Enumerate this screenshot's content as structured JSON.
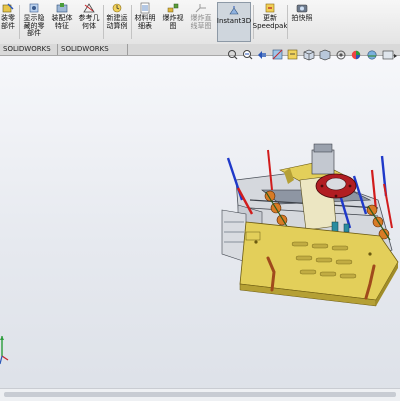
{
  "toolbar": {
    "buttons": [
      {
        "key": "edit-component",
        "label": "装零\n部件",
        "icon": "edit-component-icon"
      },
      {
        "key": "show-hidden",
        "label": "显示隐\n藏的零\n部件",
        "icon": "show-hidden-icon"
      },
      {
        "key": "assembly-features",
        "label": "装配体\n特征",
        "icon": "assembly-features-icon"
      },
      {
        "key": "reference-geometry",
        "label": "参考几\n何体",
        "icon": "reference-geometry-icon"
      },
      {
        "key": "new-motion-study",
        "label": "新建运\n动算例",
        "icon": "new-motion-study-icon"
      },
      {
        "key": "bill-of-materials",
        "label": "材料明\n细表",
        "icon": "bill-of-materials-icon"
      },
      {
        "key": "exploded-view",
        "label": "爆炸视\n图",
        "icon": "exploded-view-icon"
      },
      {
        "key": "explode-line-sketch",
        "label": "爆炸直\n线草图",
        "icon": "explode-line-sketch-icon"
      },
      {
        "key": "instant3d",
        "label": "Instant3D",
        "icon": "instant3d-icon"
      },
      {
        "key": "update-speedpak",
        "label": "更新\nSpeedpak",
        "icon": "update-speedpak-icon"
      },
      {
        "key": "take-snapshot",
        "label": "拍快照",
        "icon": "snapshot-icon"
      }
    ]
  },
  "tabs": [
    {
      "label": "SOLIDWORKS 插件"
    },
    {
      "label": "SOLIDWORKS MBD"
    }
  ],
  "heads_up_toolbar": [
    "zoom-to-fit-icon",
    "zoom-area-icon",
    "previous-view-icon",
    "section-view-icon",
    "dynamic-annotation-icon",
    "view-orientation-icon",
    "display-style-icon",
    "hide-show-items-icon",
    "edit-appearance-icon",
    "apply-scene-icon",
    "view-settings-icon"
  ],
  "colors": {
    "plate": "#e3cf5a",
    "plate_dark": "#b5a035",
    "slot": "#a04a1c",
    "flange": "#b11d22",
    "rod_blue": "#1f39c9",
    "rod_red": "#d11c1c",
    "gear": "#d87b25",
    "frame": "#6e7582",
    "casting": "#d0d3d8"
  }
}
